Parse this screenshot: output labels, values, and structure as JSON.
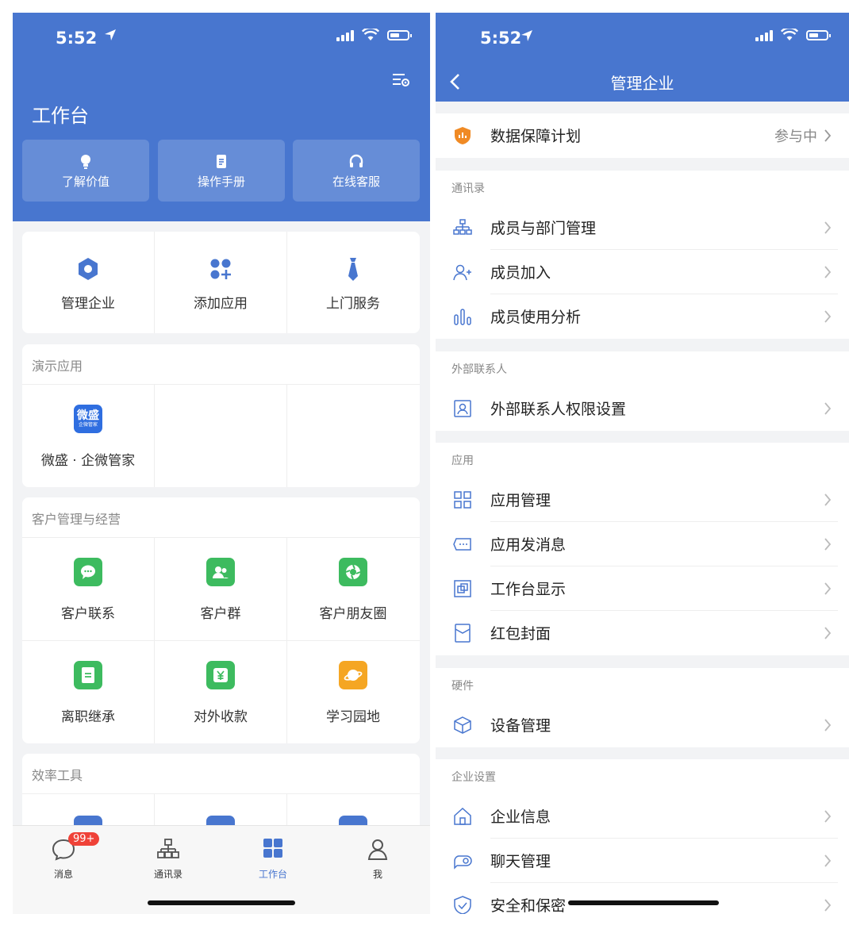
{
  "left": {
    "status": {
      "time": "5:52"
    },
    "header": {
      "title": "工作台"
    },
    "quick_actions": [
      {
        "label": "了解价值",
        "icon": "lightbulb-icon"
      },
      {
        "label": "操作手册",
        "icon": "document-icon"
      },
      {
        "label": "在线客服",
        "icon": "headphones-icon"
      }
    ],
    "top_grid": [
      {
        "label": "管理企业",
        "icon": "hexagon-icon"
      },
      {
        "label": "添加应用",
        "icon": "add-apps-icon"
      },
      {
        "label": "上门服务",
        "icon": "tie-icon"
      }
    ],
    "demo_section": {
      "title": "演示应用",
      "app_label": "微盛 · 企微管家",
      "logo_text": "微盛",
      "logo_subtext": "企微管家"
    },
    "customer_section": {
      "title": "客户管理与经营",
      "items": [
        {
          "label": "客户联系",
          "icon": "chat-icon",
          "color": "#3dbb5f"
        },
        {
          "label": "客户群",
          "icon": "group-icon",
          "color": "#3dbb5f"
        },
        {
          "label": "客户朋友圈",
          "icon": "moments-icon",
          "color": "#3dbb5f"
        },
        {
          "label": "离职继承",
          "icon": "transfer-icon",
          "color": "#3dbb5f"
        },
        {
          "label": "对外收款",
          "icon": "payment-icon",
          "color": "#3dbb5f"
        },
        {
          "label": "学习园地",
          "icon": "planet-icon",
          "color": "#f5a623"
        }
      ]
    },
    "efficiency_section": {
      "title": "效率工具"
    },
    "tabbar": [
      {
        "label": "消息",
        "icon": "message-icon",
        "badge": "99+"
      },
      {
        "label": "通讯录",
        "icon": "contacts-icon"
      },
      {
        "label": "工作台",
        "icon": "workbench-icon",
        "active": true
      },
      {
        "label": "我",
        "icon": "profile-icon"
      }
    ],
    "accent_color": "#4876cf"
  },
  "right": {
    "status": {
      "time": "5:52"
    },
    "nav": {
      "title": "管理企业"
    },
    "data_plan": {
      "label": "数据保障计划",
      "status": "参与中"
    },
    "sections": [
      {
        "title": "通讯录",
        "rows": [
          {
            "label": "成员与部门管理",
            "icon": "org-chart-icon"
          },
          {
            "label": "成员加入",
            "icon": "add-member-icon"
          },
          {
            "label": "成员使用分析",
            "icon": "bar-chart-icon"
          }
        ]
      },
      {
        "title": "外部联系人",
        "rows": [
          {
            "label": "外部联系人权限设置",
            "icon": "contact-card-icon"
          }
        ]
      },
      {
        "title": "应用",
        "rows": [
          {
            "label": "应用管理",
            "icon": "grid-icon"
          },
          {
            "label": "应用发消息",
            "icon": "message-bubble-icon"
          },
          {
            "label": "工作台显示",
            "icon": "display-icon"
          },
          {
            "label": "红包封面",
            "icon": "red-packet-icon"
          }
        ]
      },
      {
        "title": "硬件",
        "rows": [
          {
            "label": "设备管理",
            "icon": "cube-icon"
          }
        ]
      },
      {
        "title": "企业设置",
        "rows": [
          {
            "label": "企业信息",
            "icon": "home-icon"
          },
          {
            "label": "聊天管理",
            "icon": "chat-toggle-icon"
          },
          {
            "label": "安全和保密",
            "icon": "shield-icon"
          }
        ]
      }
    ]
  }
}
